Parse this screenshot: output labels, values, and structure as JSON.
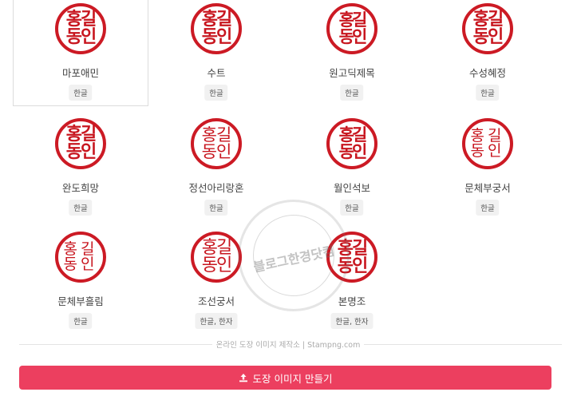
{
  "accent_color": "#ec3f5f",
  "seal_color": "#cc1a24",
  "seal_text": {
    "line1": "홍길",
    "line2": "동인"
  },
  "fonts": [
    {
      "name": "마포애민",
      "tag": "한글",
      "selected": true
    },
    {
      "name": "수트",
      "tag": "한글"
    },
    {
      "name": "원고딕제목",
      "tag": "한글"
    },
    {
      "name": "수성혜정",
      "tag": "한글"
    },
    {
      "name": "완도희망",
      "tag": "한글"
    },
    {
      "name": "정선아리랑혼",
      "tag": "한글"
    },
    {
      "name": "월인석보",
      "tag": "한글"
    },
    {
      "name": "문체부궁서",
      "tag": "한글"
    },
    {
      "name": "문체부흘림",
      "tag": "한글"
    },
    {
      "name": "조선궁서",
      "tag": "한글, 한자"
    },
    {
      "name": "본명조",
      "tag": "한글, 한자"
    }
  ],
  "footer_note": "온라인 도장 이미지 제작소 | Stampng.com",
  "make_button": {
    "label": "도장 이미지 만들기",
    "icon": "upload-icon"
  },
  "watermark": {
    "text": "블로그한경닷컴"
  }
}
